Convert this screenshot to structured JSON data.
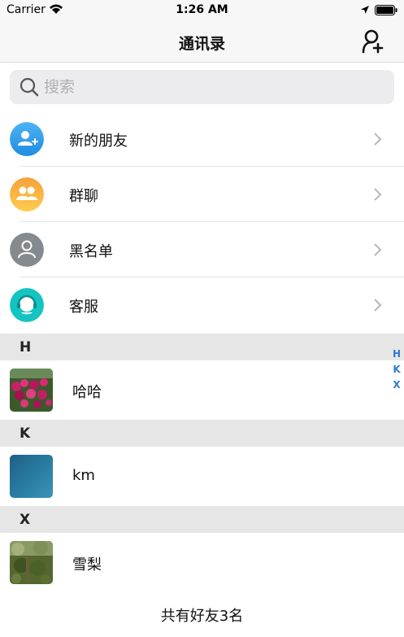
{
  "status_bar": {
    "carrier": "Carrier",
    "time": "1:26 AM",
    "icons": [
      "wifi-icon",
      "location-arrow-icon",
      "battery-icon"
    ]
  },
  "nav": {
    "title": "通讯录",
    "right_icon": "add-friend-icon"
  },
  "search": {
    "placeholder": "搜索",
    "value": ""
  },
  "functions": [
    {
      "label": "新的朋友",
      "icon": "new-friend-icon",
      "color": "#2f9be8"
    },
    {
      "label": "群聊",
      "icon": "group-chat-icon",
      "color": "#f6a623"
    },
    {
      "label": "黑名单",
      "icon": "blacklist-icon",
      "color": "#858a8e"
    },
    {
      "label": "客服",
      "icon": "customer-service-icon",
      "color": "#13c4c2"
    }
  ],
  "sections": [
    {
      "letter": "H",
      "contacts": [
        {
          "name": "哈哈",
          "avatar": "flowers-photo"
        }
      ]
    },
    {
      "letter": "K",
      "contacts": [
        {
          "name": "km",
          "avatar": "blue-gradient"
        }
      ]
    },
    {
      "letter": "X",
      "contacts": [
        {
          "name": "雪梨",
          "avatar": "garden-photo"
        }
      ]
    }
  ],
  "index_letters": [
    "H",
    "K",
    "X"
  ],
  "footer": {
    "count_text": "共有好友3名"
  },
  "colors": {
    "index_accent": "#2f7ad1",
    "section_bg": "#e6e6e6"
  }
}
